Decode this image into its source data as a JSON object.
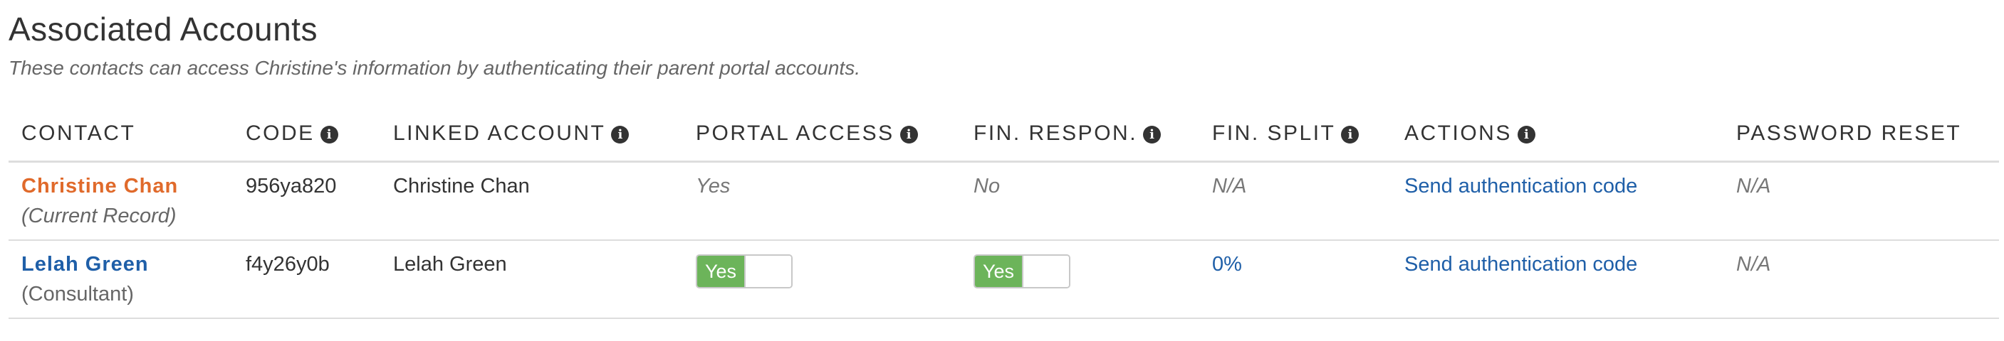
{
  "section": {
    "title": "Associated Accounts",
    "subtitle": "These contacts can access Christine's information by authenticating their parent portal accounts."
  },
  "columns": {
    "contact": "CONTACT",
    "code": "CODE",
    "linked_account": "LINKED ACCOUNT",
    "portal_access": "PORTAL ACCESS",
    "fin_respon": "FIN. RESPON.",
    "fin_split": "FIN. SPLIT",
    "actions": "ACTIONS",
    "password_reset": "PASSWORD RESET"
  },
  "info_icon_glyph": "i",
  "rows": [
    {
      "contact_name": "Christine Chan",
      "contact_role": "(Current Record)",
      "code": "956ya820",
      "linked_account": "Christine Chan",
      "portal_access": "Yes",
      "fin_respon": "No",
      "fin_split": "N/A",
      "action": "Send authentication code",
      "password_reset": "N/A"
    },
    {
      "contact_name": "Lelah Green",
      "contact_role": "(Consultant)",
      "code": "f4y26y0b",
      "linked_account": "Lelah Green",
      "portal_access": "Yes",
      "fin_respon": "Yes",
      "fin_split": "0%",
      "action": "Send authentication code",
      "password_reset": "N/A"
    }
  ],
  "colors": {
    "current_record": "#e06a2b",
    "link": "#1f5fa8",
    "toggle_on": "#6cb45a"
  }
}
